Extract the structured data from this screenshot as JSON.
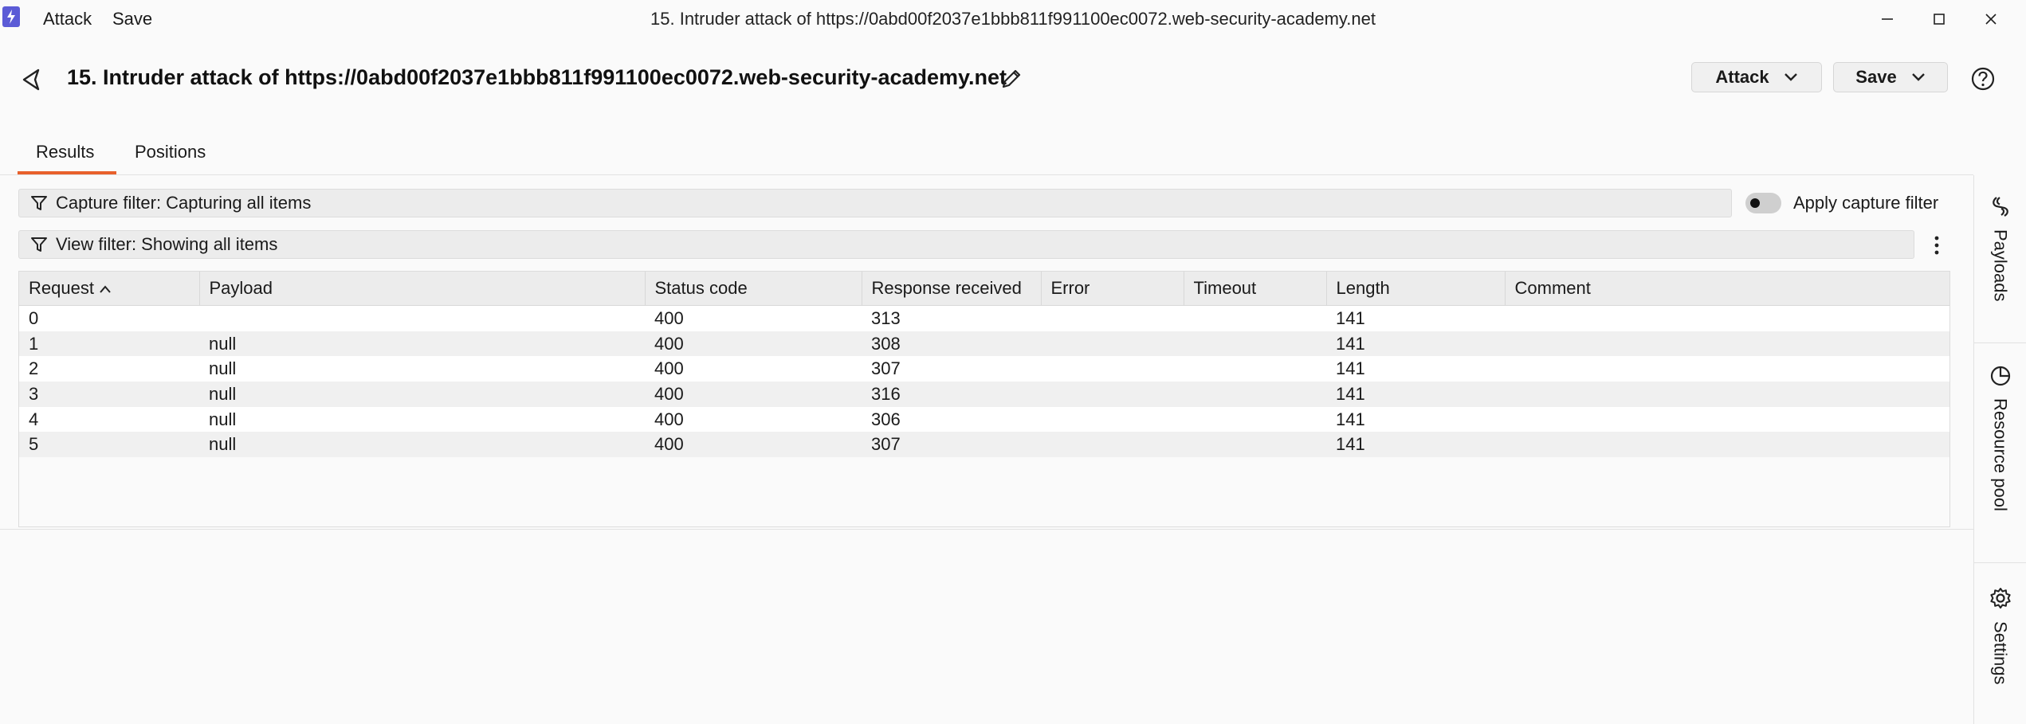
{
  "titlebar": {
    "menu": [
      "Attack",
      "Save"
    ],
    "window_title": "15. Intruder attack of https://0abd00f2037e1bbb811f991100ec0072.web-security-academy.net"
  },
  "header": {
    "title": "15. Intruder attack of https://0abd00f2037e1bbb811f991100ec0072.web-security-academy.net",
    "attack_button": "Attack",
    "save_button": "Save"
  },
  "tabs": [
    {
      "label": "Results",
      "active": true
    },
    {
      "label": "Positions",
      "active": false
    }
  ],
  "filters": {
    "capture_filter": "Capture filter: Capturing all items",
    "apply_capture_filter_label": "Apply capture filter",
    "apply_capture_filter_on": false,
    "view_filter": "View filter: Showing all items"
  },
  "side_panel": [
    {
      "label": "Payloads",
      "icon": "payloads-icon"
    },
    {
      "label": "Resource pool",
      "icon": "pie-chart-icon"
    },
    {
      "label": "Settings",
      "icon": "gear-icon"
    }
  ],
  "table": {
    "columns": [
      "Request",
      "Payload",
      "Status code",
      "Response received",
      "Error",
      "Timeout",
      "Length",
      "Comment"
    ],
    "sort_column": "Request",
    "rows": [
      [
        "0",
        "",
        "400",
        "313",
        "",
        "",
        "141",
        ""
      ],
      [
        "1",
        "null",
        "400",
        "308",
        "",
        "",
        "141",
        ""
      ],
      [
        "2",
        "null",
        "400",
        "307",
        "",
        "",
        "141",
        ""
      ],
      [
        "3",
        "null",
        "400",
        "316",
        "",
        "",
        "141",
        ""
      ],
      [
        "4",
        "null",
        "400",
        "306",
        "",
        "",
        "141",
        ""
      ],
      [
        "5",
        "null",
        "400",
        "307",
        "",
        "",
        "141",
        ""
      ]
    ]
  },
  "colors": {
    "accent": "#e8612c",
    "app_icon": "#5b5bd6"
  }
}
